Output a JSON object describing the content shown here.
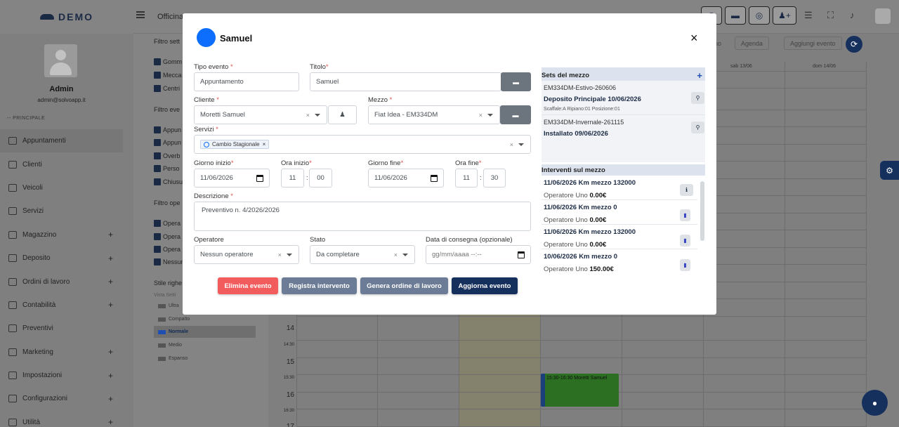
{
  "app": {
    "brand": "DEMO",
    "topbar_title": "Officina"
  },
  "sidebar": {
    "user_name": "Admin",
    "user_email": "admin@solvoapp.it",
    "section": "-- PRINCIPALE",
    "items": [
      {
        "label": "Appuntamenti",
        "plus": false,
        "active": true
      },
      {
        "label": "Clienti",
        "plus": false
      },
      {
        "label": "Veicoli",
        "plus": false
      },
      {
        "label": "Servizi",
        "plus": false
      },
      {
        "label": "Magazzino",
        "plus": true
      },
      {
        "label": "Deposito",
        "plus": true
      },
      {
        "label": "Ordini di lavoro",
        "plus": true
      },
      {
        "label": "Contabilità",
        "plus": true
      },
      {
        "label": "Preventivi",
        "plus": false
      },
      {
        "label": "Marketing",
        "plus": true
      },
      {
        "label": "Impostazioni",
        "plus": true
      },
      {
        "label": "Configurazioni",
        "plus": true
      },
      {
        "label": "Utilità",
        "plus": true
      }
    ],
    "plus_glyph": "+"
  },
  "filters": {
    "f1_title": "Filtro sett",
    "f1_items": [
      "Gomm",
      "Mecca",
      "Centri"
    ],
    "f2_title": "Filtro eve",
    "f2_items": [
      "Appun",
      "Appun",
      "Overb",
      "Perso",
      "Chiusu"
    ],
    "f3_title": "Filtro ope",
    "f3_items": [
      "Opera",
      "Opera",
      "Opera",
      "Nessun"
    ],
    "style_title": "Stile righe",
    "style_sub": "Vista Setti",
    "styles": [
      "Ultra",
      "Compatto",
      "Normale",
      "Medio",
      "Espanso"
    ]
  },
  "calendar": {
    "buttons": [
      "rno",
      "Agenda",
      "Aggiungi evento"
    ],
    "days": [
      "sab 13/06",
      "dom 14/06"
    ],
    "hours": [
      "14",
      "14:30",
      "15",
      "15:30",
      "16",
      "16:30",
      "17"
    ],
    "event": "15:30-16:30 Moretti Samuel"
  },
  "modal": {
    "title": "Samuel",
    "close": "×",
    "tipo_evento": {
      "label": "Tipo evento",
      "value": "Appuntamento"
    },
    "titolo": {
      "label": "Titolo",
      "value": "Samuel"
    },
    "cliente": {
      "label": "Cliente",
      "value": "Moretti Samuel"
    },
    "mezzo": {
      "label": "Mezzo",
      "value": "Fiat Idea - EM334DM"
    },
    "servizi": {
      "label": "Servizi",
      "tag": "Cambio Stagionale",
      "tag_x": "×"
    },
    "giorno_inizio": {
      "label": "Giorno inizio",
      "value": "11/06/2026"
    },
    "ora_inizio": {
      "label": "Ora inizio",
      "h": "11",
      "m": "00"
    },
    "giorno_fine": {
      "label": "Giorno fine",
      "value": "11/06/2026"
    },
    "ora_fine": {
      "label": "Ora fine",
      "h": "11",
      "m": "30"
    },
    "descrizione": {
      "label": "Descrizione",
      "value": "Preventivo n. 4/2026/2026"
    },
    "operatore": {
      "label": "Operatore",
      "value": "Nessun operatore"
    },
    "stato": {
      "label": "Stato",
      "value": "Da completare"
    },
    "consegna": {
      "label": "Data di consegna (opzionale)",
      "placeholder": "gg/mm/aaaa --:--"
    },
    "clear_x": "×",
    "colon": ":",
    "required": "*",
    "buttons": {
      "elimina": "Elimina evento",
      "registra": "Registra intervento",
      "genera": "Genera ordine di lavoro",
      "aggiorna": "Aggiorna evento"
    },
    "sets": {
      "title": "Sets del mezzo",
      "add": "+",
      "items": [
        {
          "code": "EM334DM-Estivo-260606",
          "status": "Deposito Principale 10/06/2026",
          "location": "Scaffale:A Ripiano:01 Posizione:01"
        },
        {
          "code": "EM334DM-Invernale-261115",
          "status": "Installato 09/06/2026",
          "location": ""
        }
      ]
    },
    "interventi": {
      "title": "Interventi sul mezzo",
      "items": [
        {
          "date": "11/06/2026",
          "km": "Km mezzo 132000",
          "operator": "Operatore Uno",
          "amount": "0.00€"
        },
        {
          "date": "11/06/2026",
          "km": "Km mezzo 0",
          "operator": "Operatore Uno",
          "amount": "0.00€"
        },
        {
          "date": "11/06/2026",
          "km": "Km mezzo 132000",
          "operator": "Operatore Uno",
          "amount": "0.00€"
        },
        {
          "date": "10/06/2026",
          "km": "Km mezzo 0",
          "operator": "Operatore Uno",
          "amount": "150.00€"
        }
      ]
    }
  },
  "colors": {
    "primary": "#16305e",
    "blue": "#0d6efd",
    "danger": "#f25c5c",
    "secondary": "#6c7c96",
    "event_green": "#2c6e22"
  }
}
